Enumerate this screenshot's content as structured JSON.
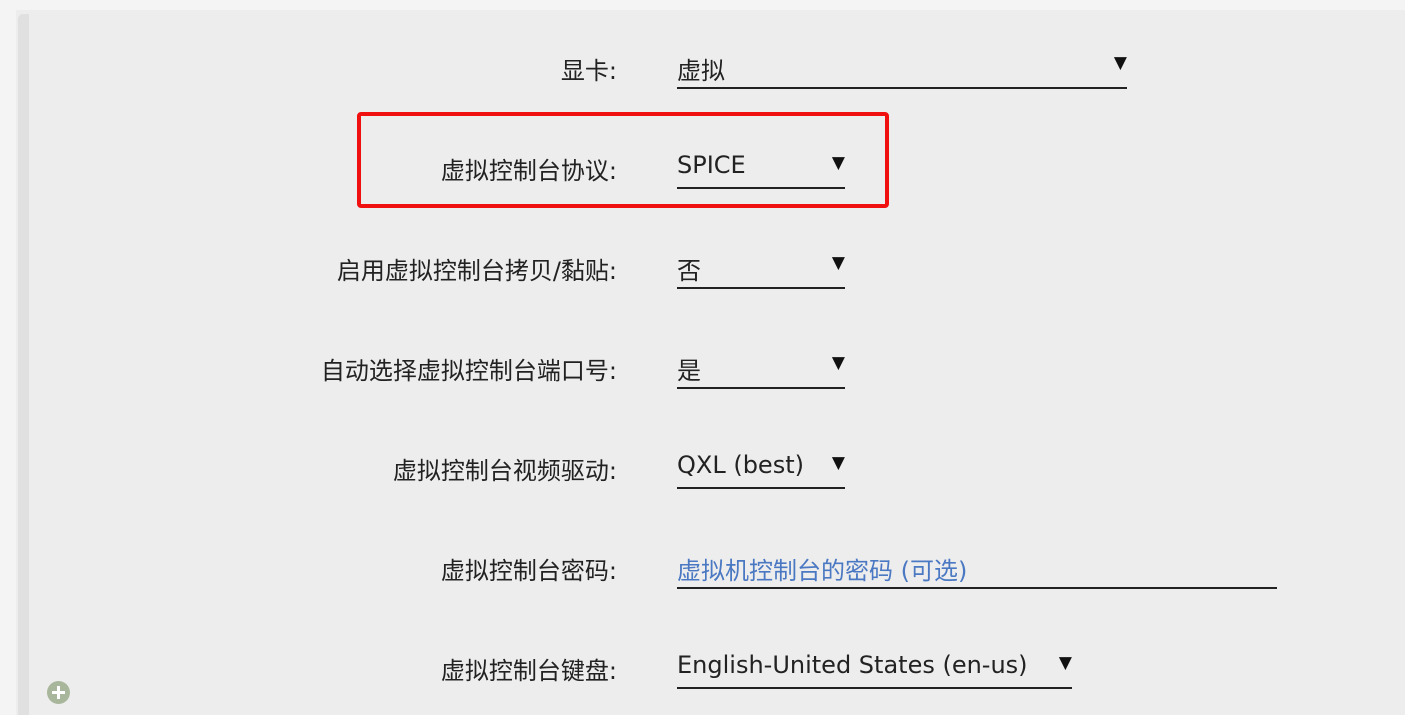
{
  "fields": {
    "graphics": {
      "label": "显卡:",
      "value": "虚拟"
    },
    "console_protocol": {
      "label": "虚拟控制台协议:",
      "value": "SPICE"
    },
    "console_copy_paste": {
      "label": "启用虚拟控制台拷贝/黏贴:",
      "value": "否"
    },
    "auto_port": {
      "label": "自动选择虚拟控制台端口号:",
      "value": "是"
    },
    "video_driver": {
      "label": "虚拟控制台视频驱动:",
      "value": "QXL (best)"
    },
    "console_password": {
      "label": "虚拟控制台密码:",
      "placeholder": "虚拟机控制台的密码 (可选)"
    },
    "console_keyboard": {
      "label": "虚拟控制台键盘:",
      "value": "English-United States (en-us)"
    }
  },
  "dropdown_caret": "▼",
  "icons": {
    "add": "plus-circle-icon",
    "caret": "dropdown-caret-icon"
  },
  "colors": {
    "highlight": "#f01010",
    "placeholder": "#4a78c2",
    "add_icon": "#a8b79b"
  }
}
